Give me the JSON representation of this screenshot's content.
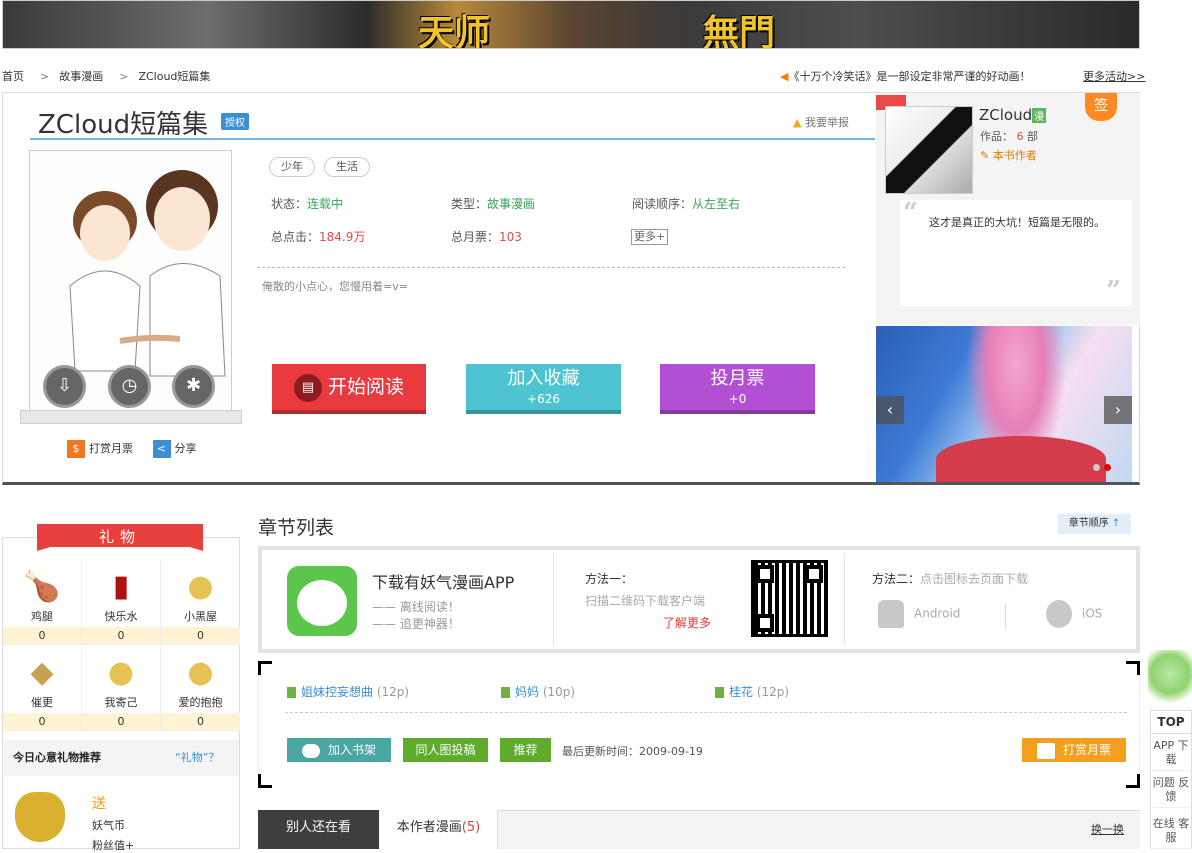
{
  "banner": {
    "left_text": "天师",
    "right_text": "無門"
  },
  "breadcrumb": {
    "home": "首页",
    "category": "故事漫画",
    "current": "ZCloud短篇集"
  },
  "notice": {
    "text": "《十万个冷笑话》是一部设定非常严谨的好动画！",
    "more": "更多活动>>"
  },
  "comic": {
    "title": "ZCloud短篇集",
    "license": "授权",
    "report": "我要举报",
    "tags": [
      "少年",
      "生活"
    ],
    "status_label": "状态：",
    "status": "连载中",
    "type_label": "类型：",
    "type": "故事漫画",
    "order_label": "阅读顺序：",
    "order": "从左至右",
    "clicks_label": "总点击：",
    "clicks": "184.9万",
    "votes_label": "总月票：",
    "votes": "103",
    "more": "更多+",
    "description": "俺散的小点心，您慢用着=v=",
    "read_btn": "开始阅读",
    "fav_btn": "加入收藏",
    "fav_count": "+626",
    "vote_btn": "投月票",
    "vote_count": "+0",
    "reward": "打赏月票",
    "share": "分享"
  },
  "author": {
    "name": "ZCloud",
    "badge_man": "漫",
    "works_label": "作品：",
    "works": "6",
    "works_unit": "部",
    "badge": "本书作者",
    "sign": "签",
    "quote": "这才是真正的大坑！短篇是无限的。"
  },
  "gifts": {
    "ribbon": "礼物",
    "items": [
      {
        "name": "鸡腿",
        "count": "0",
        "icon": "drumstick-icon"
      },
      {
        "name": "快乐水",
        "count": "0",
        "icon": "cola-icon"
      },
      {
        "name": "小黑屋",
        "count": "0",
        "icon": "dark-room-icon"
      },
      {
        "name": "催更",
        "count": "0",
        "icon": "urge-icon"
      },
      {
        "name": "我寄己",
        "count": "0",
        "icon": "myself-icon"
      },
      {
        "name": "爱的抱抱",
        "count": "0",
        "icon": "hug-icon"
      }
    ],
    "reco_title": "今日心意礼物推荐",
    "reco_link": "“礼物”？",
    "send": "送",
    "coin": "妖气币",
    "fans": "粉丝值+"
  },
  "chapters": {
    "title": "章节列表",
    "order": "章节顺序",
    "app_title": "下载有妖气漫画APP",
    "app_line1": "—— 离线阅读！",
    "app_line2": "—— 追更神器！",
    "method1": "方法一：",
    "method1_desc": "扫描二维码下载客户端",
    "learn_more": "了解更多",
    "method2": "方法二：",
    "method2_desc": "点击图标去页面下载",
    "android": "Android",
    "ios": "iOS",
    "list": [
      {
        "name": "姐妹控妄想曲",
        "pages": "(12p)"
      },
      {
        "name": "妈妈",
        "pages": "(10p)"
      },
      {
        "name": "桂花",
        "pages": "(12p)"
      }
    ],
    "add_shelf": "加入书架",
    "submit": "同人图投稿",
    "recommend": "推荐",
    "last_update": "最后更新时间：2009-09-19",
    "reward": "打赏月票"
  },
  "tabs": {
    "others": "别人还在看",
    "author_works": "本作者漫画",
    "author_count": "(5)",
    "swap": "换一换"
  },
  "side": {
    "top": "TOP",
    "app": "APP 下载",
    "feedback": "问题 反馈",
    "service": "在线 客服"
  },
  "colors": {
    "read": "#e83a3f",
    "fav": "#4ec3d1",
    "vote": "#b24fd3",
    "accent_blue": "#3c8fd6",
    "green": "#3aa655"
  }
}
